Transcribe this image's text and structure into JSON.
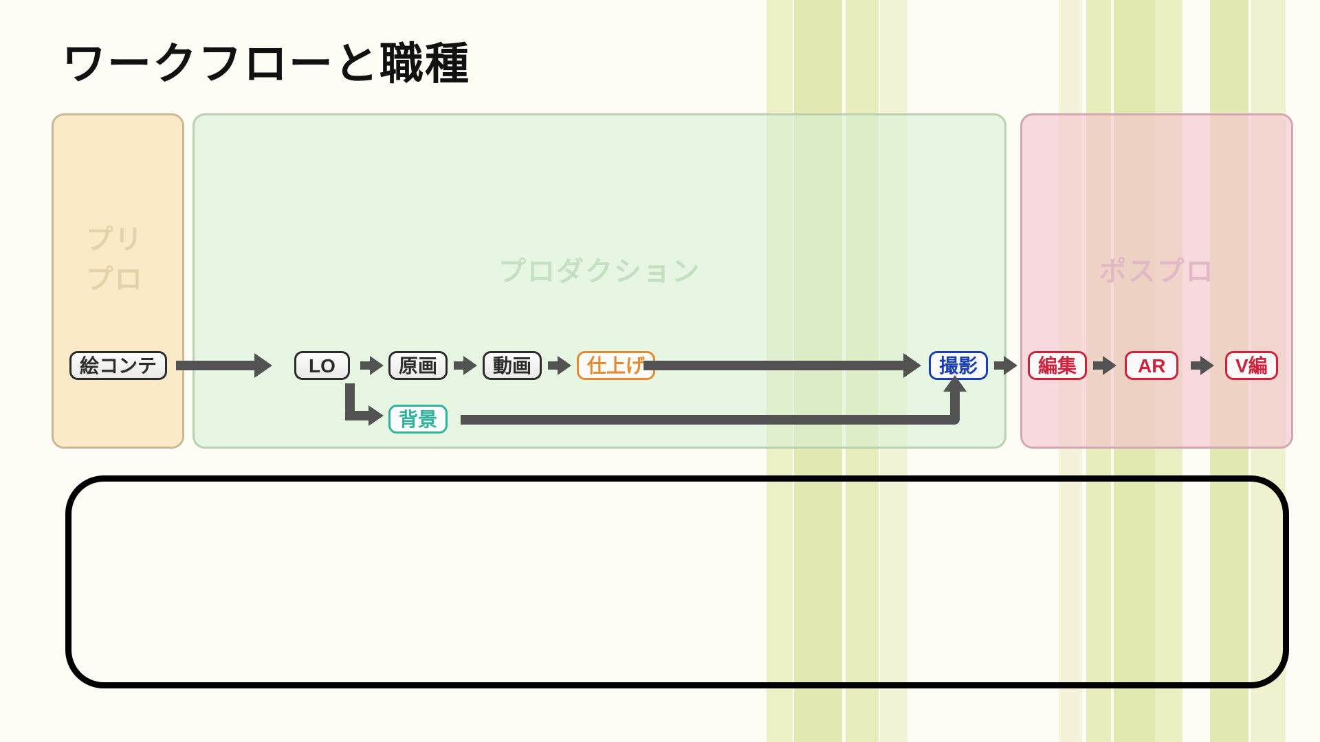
{
  "title": "ワークフローと職種",
  "phases": {
    "pre": {
      "label": "プリプロ"
    },
    "main": {
      "label": "プロダクション"
    },
    "post": {
      "label": "ポスプロ"
    }
  },
  "nodes": {
    "econte": "絵コンテ",
    "lo": "LO",
    "genga": "原画",
    "douga": "動画",
    "shiage": "仕上げ",
    "haikei": "背景",
    "satsuei": "撮影",
    "henshuu": "編集",
    "ar": "AR",
    "vhen": "V編"
  }
}
